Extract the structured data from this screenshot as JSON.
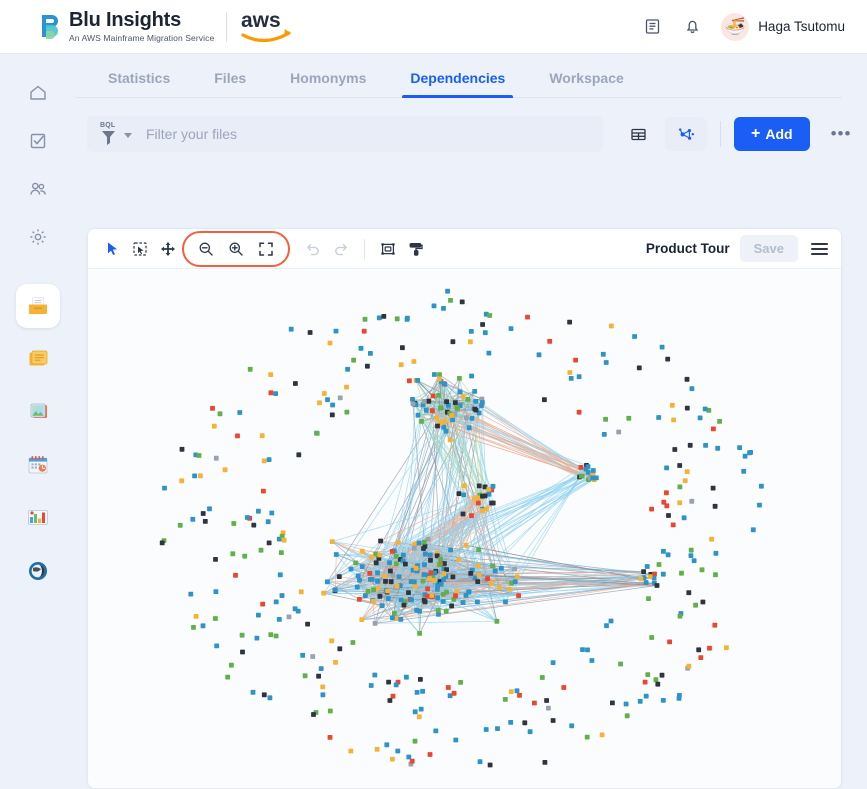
{
  "header": {
    "brand_title": "Blu Insights",
    "brand_subtitle": "An AWS Mainframe Migration Service",
    "aws_wordmark": "aws",
    "docs_icon": "book-icon",
    "notifications_icon": "bell-icon",
    "avatar_glyph": "🍜",
    "user_name": "Haga Tsutomu"
  },
  "rail": {
    "nav_items": [
      {
        "name": "home",
        "icon": "home-icon"
      },
      {
        "name": "tasks",
        "icon": "checkbox-icon"
      },
      {
        "name": "users",
        "icon": "users-icon"
      },
      {
        "name": "settings",
        "icon": "gear-icon"
      }
    ],
    "app_items": [
      {
        "name": "card-file-box",
        "glyph": "🗂️",
        "active": true
      },
      {
        "name": "card-index",
        "glyph": "📇",
        "active": false
      },
      {
        "name": "framed-picture",
        "glyph": "🖼️",
        "active": false
      },
      {
        "name": "calendar",
        "glyph": "📅",
        "active": false
      },
      {
        "name": "chart-board",
        "glyph": "📊",
        "active": false
      },
      {
        "name": "globe",
        "glyph": "🌀",
        "active": false
      }
    ]
  },
  "tabs": [
    {
      "label": "Statistics",
      "active": false
    },
    {
      "label": "Files",
      "active": false
    },
    {
      "label": "Homonyms",
      "active": false
    },
    {
      "label": "Dependencies",
      "active": true
    },
    {
      "label": "Workspace",
      "active": false
    }
  ],
  "filter": {
    "bql_label": "BQL",
    "funnel_icon": "funnel-icon",
    "caret_icon": "chevron-down-icon",
    "placeholder": "Filter your files",
    "value": "",
    "table_view_icon": "table-view-icon",
    "graph_view_icon": "graph-view-icon",
    "add_label": "Add",
    "add_plus": "+",
    "overflow_label": "•••"
  },
  "toolbar": {
    "select_icon": "cursor-pointer-icon",
    "marquee_icon": "box-select-icon",
    "pan_icon": "move-arrows-icon",
    "zoom_out_icon": "zoom-out-icon",
    "zoom_in_icon": "zoom-in-icon",
    "fit_screen_icon": "fit-screen-icon",
    "undo_icon": "undo-icon",
    "redo_icon": "redo-icon",
    "frame_icon": "fit-selection-icon",
    "style_icon": "paint-roller-icon",
    "product_tour_label": "Product Tour",
    "save_label": "Save",
    "menu_icon": "hamburger-menu-icon"
  },
  "colors": {
    "accent_blue": "#1a5ef5",
    "highlight_ring": "#f4603e",
    "page_bg": "#edf1fa",
    "card_bg": "#fcfdff",
    "node_blue": "#2e93c8",
    "node_amber": "#f5b335",
    "node_green": "#62b04a",
    "node_red": "#ea4632",
    "node_dark": "#2f3540",
    "node_grey": "#98a2b0",
    "edge_blue": "#8fd2ee",
    "edge_grey": "#8b93a0",
    "edge_salmon": "#eeab8e",
    "edge_green": "#b6dba6"
  },
  "graph": {
    "type": "network",
    "description": "Dependency graph of source files — dense multi-cluster core with a surrounding halo of isolated nodes",
    "node_count_visible": 620,
    "clusters": [
      {
        "name": "upper-core",
        "cx": 0.47,
        "cy": 0.27,
        "r": 0.13
      },
      {
        "name": "lower-core",
        "cx": 0.45,
        "cy": 0.6,
        "r": 0.22
      },
      {
        "name": "right-hub",
        "cx": 0.74,
        "cy": 0.6,
        "r": 0.05
      },
      {
        "name": "fan-right",
        "cx": 0.66,
        "cy": 0.4,
        "r": 0.05
      },
      {
        "name": "halo",
        "cx": 0.5,
        "cy": 0.5,
        "r": 0.46
      }
    ],
    "node_palette_weights": [
      0.38,
      0.18,
      0.14,
      0.11,
      0.15,
      0.04
    ]
  }
}
